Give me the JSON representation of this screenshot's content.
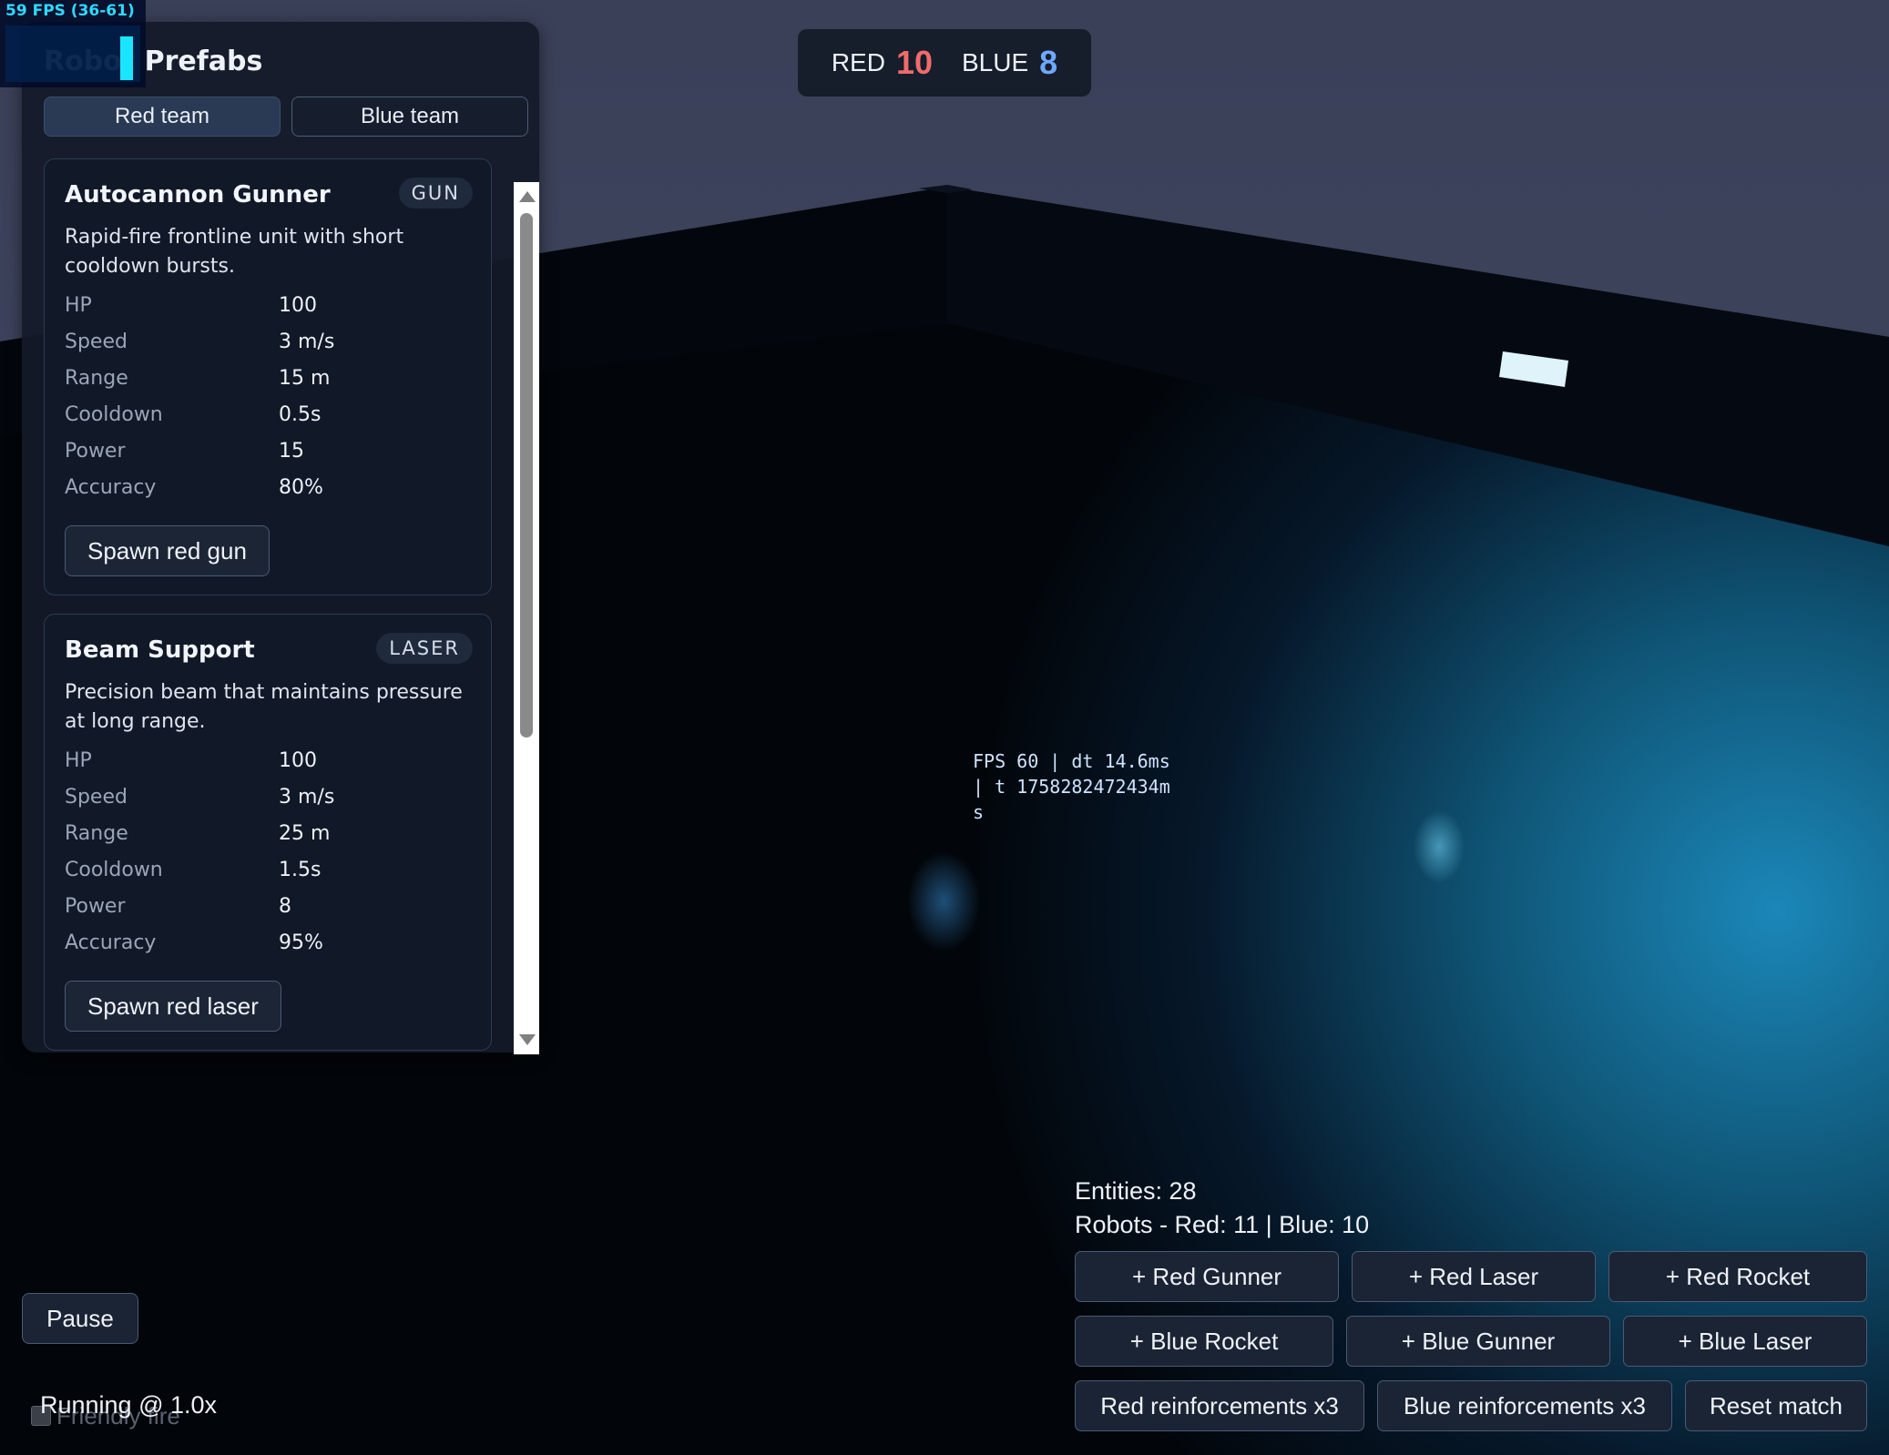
{
  "fps_meter": {
    "text": "59 FPS (36-61)",
    "accent": "#19e5ff"
  },
  "panel": {
    "title": "Robot Prefabs",
    "tabs": [
      {
        "label": "Red team",
        "active": true
      },
      {
        "label": "Blue team",
        "active": false
      }
    ],
    "cards": [
      {
        "name": "Autocannon Gunner",
        "badge": "GUN",
        "description": "Rapid-fire frontline unit with short cooldown bursts.",
        "stats": [
          {
            "label": "HP",
            "value": "100"
          },
          {
            "label": "Speed",
            "value": "3 m/s"
          },
          {
            "label": "Range",
            "value": "15 m"
          },
          {
            "label": "Cooldown",
            "value": "0.5s"
          },
          {
            "label": "Power",
            "value": "15"
          },
          {
            "label": "Accuracy",
            "value": "80%"
          }
        ],
        "spawn_label": "Spawn red gun"
      },
      {
        "name": "Beam Support",
        "badge": "LASER",
        "description": "Precision beam that maintains pressure at long range.",
        "stats": [
          {
            "label": "HP",
            "value": "100"
          },
          {
            "label": "Speed",
            "value": "3 m/s"
          },
          {
            "label": "Range",
            "value": "25 m"
          },
          {
            "label": "Cooldown",
            "value": "1.5s"
          },
          {
            "label": "Power",
            "value": "8"
          },
          {
            "label": "Accuracy",
            "value": "95%"
          }
        ],
        "spawn_label": "Spawn red laser"
      }
    ]
  },
  "scoreboard": {
    "red_label": "RED",
    "red_score": "10",
    "blue_label": "BLUE",
    "blue_score": "8",
    "red_color": "#f06b6b",
    "blue_color": "#6ea8ff"
  },
  "debug": {
    "text": "FPS 60 | dt 14.6ms | t 1758282472434ms"
  },
  "stats": {
    "entities": "Entities: 28",
    "robots": "Robots - Red: 11 | Blue: 10"
  },
  "controls": {
    "red_gunner": "+ Red Gunner",
    "red_laser": "+ Red Laser",
    "red_rocket": "+ Red Rocket",
    "blue_rocket": "+ Blue Rocket",
    "blue_gunner": "+ Blue Gunner",
    "blue_laser": "+ Blue Laser",
    "red_reinforcements": "Red reinforcements x3",
    "blue_reinforcements": "Blue reinforcements x3",
    "reset": "Reset match"
  },
  "sim": {
    "pause_label": "Pause",
    "friendly_fire_label": "Friendly fire",
    "friendly_fire_checked": false,
    "running_text": "Running @ 1.0x"
  }
}
